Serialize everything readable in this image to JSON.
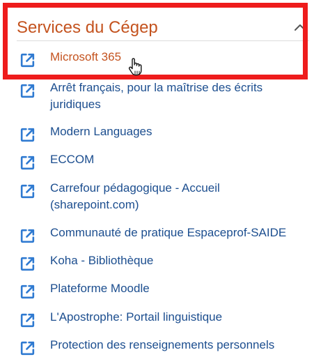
{
  "section": {
    "title": "Services du Cégep",
    "toggle_icon": "chevron-up-icon"
  },
  "links": [
    {
      "label": "Microsoft 365",
      "icon": "external-link-icon",
      "active": true
    },
    {
      "label": "Arrêt français, pour la maîtrise des écrits juridiques",
      "icon": "external-link-icon",
      "active": false
    },
    {
      "label": "Modern Languages",
      "icon": "external-link-icon",
      "active": false
    },
    {
      "label": "ECCOM",
      "icon": "external-link-icon",
      "active": false
    },
    {
      "label": "Carrefour pédagogique - Accueil (sharepoint.com)",
      "icon": "external-link-icon",
      "active": false
    },
    {
      "label": "Communauté de pratique Espaceprof-SAIDE",
      "icon": "external-link-icon",
      "active": false
    },
    {
      "label": "Koha - Bibliothèque",
      "icon": "external-link-icon",
      "active": false
    },
    {
      "label": "Plateforme Moodle",
      "icon": "external-link-icon",
      "active": false
    },
    {
      "label": "L'Apostrophe: Portail linguistique",
      "icon": "external-link-icon",
      "active": false
    },
    {
      "label": "Protection des renseignements personnels",
      "icon": "external-link-icon",
      "active": false
    }
  ],
  "colors": {
    "accent": "#c4531f",
    "link": "#1c4e8f",
    "icon": "#2f7ad1",
    "highlight": "#ee1c1c"
  },
  "cursor_icon": "hand-pointer-icon"
}
